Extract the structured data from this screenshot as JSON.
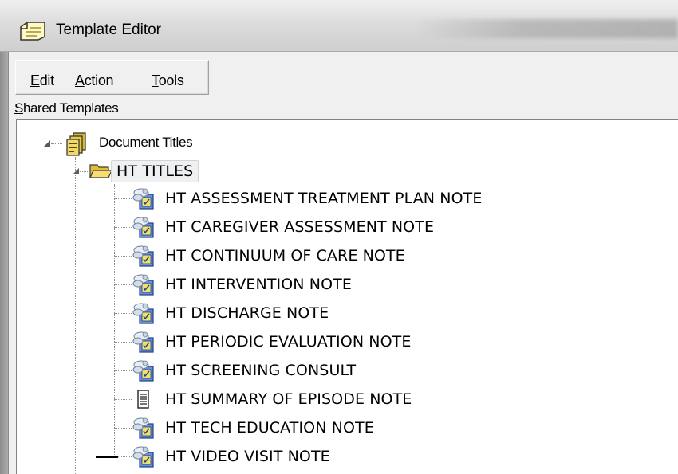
{
  "window": {
    "title": "Template Editor"
  },
  "menu": {
    "items": [
      {
        "pre": "",
        "accel": "E",
        "post": "dit"
      },
      {
        "pre": "",
        "accel": "A",
        "post": "ction"
      },
      {
        "pre": "",
        "accel": "T",
        "post": "ools"
      }
    ]
  },
  "section": {
    "accel": "S",
    "rest": "hared Templates"
  },
  "tree": {
    "root": {
      "label": "Document Titles",
      "icon": "document-titles-icon",
      "expanded": true
    },
    "folder": {
      "label": "HT TITLES",
      "icon": "open-folder-icon",
      "expanded": true
    },
    "items": [
      {
        "label": "HT ASSESSMENT TREATMENT PLAN NOTE",
        "icon": "template-note-icon"
      },
      {
        "label": "HT CAREGIVER ASSESSMENT NOTE",
        "icon": "template-note-icon"
      },
      {
        "label": "HT CONTINUUM OF CARE NOTE",
        "icon": "template-note-icon"
      },
      {
        "label": "HT INTERVENTION NOTE",
        "icon": "template-note-icon"
      },
      {
        "label": "HT DISCHARGE NOTE",
        "icon": "template-note-icon"
      },
      {
        "label": "HT PERIODIC EVALUATION NOTE",
        "icon": "template-note-icon"
      },
      {
        "label": "HT SCREENING CONSULT",
        "icon": "template-note-icon"
      },
      {
        "label": "HT SUMMARY OF EPISODE NOTE",
        "icon": "document-page-icon"
      },
      {
        "label": "HT TECH EDUCATION NOTE",
        "icon": "template-note-icon"
      },
      {
        "label": "HT VIDEO VISIT NOTE",
        "icon": "template-note-icon"
      }
    ]
  },
  "colors": {
    "selection_bg": "#eef0f2",
    "tree_line": "#8e8e8e",
    "folder_yellow": "#f4d35e",
    "note_blue": "#2e5fb8"
  }
}
